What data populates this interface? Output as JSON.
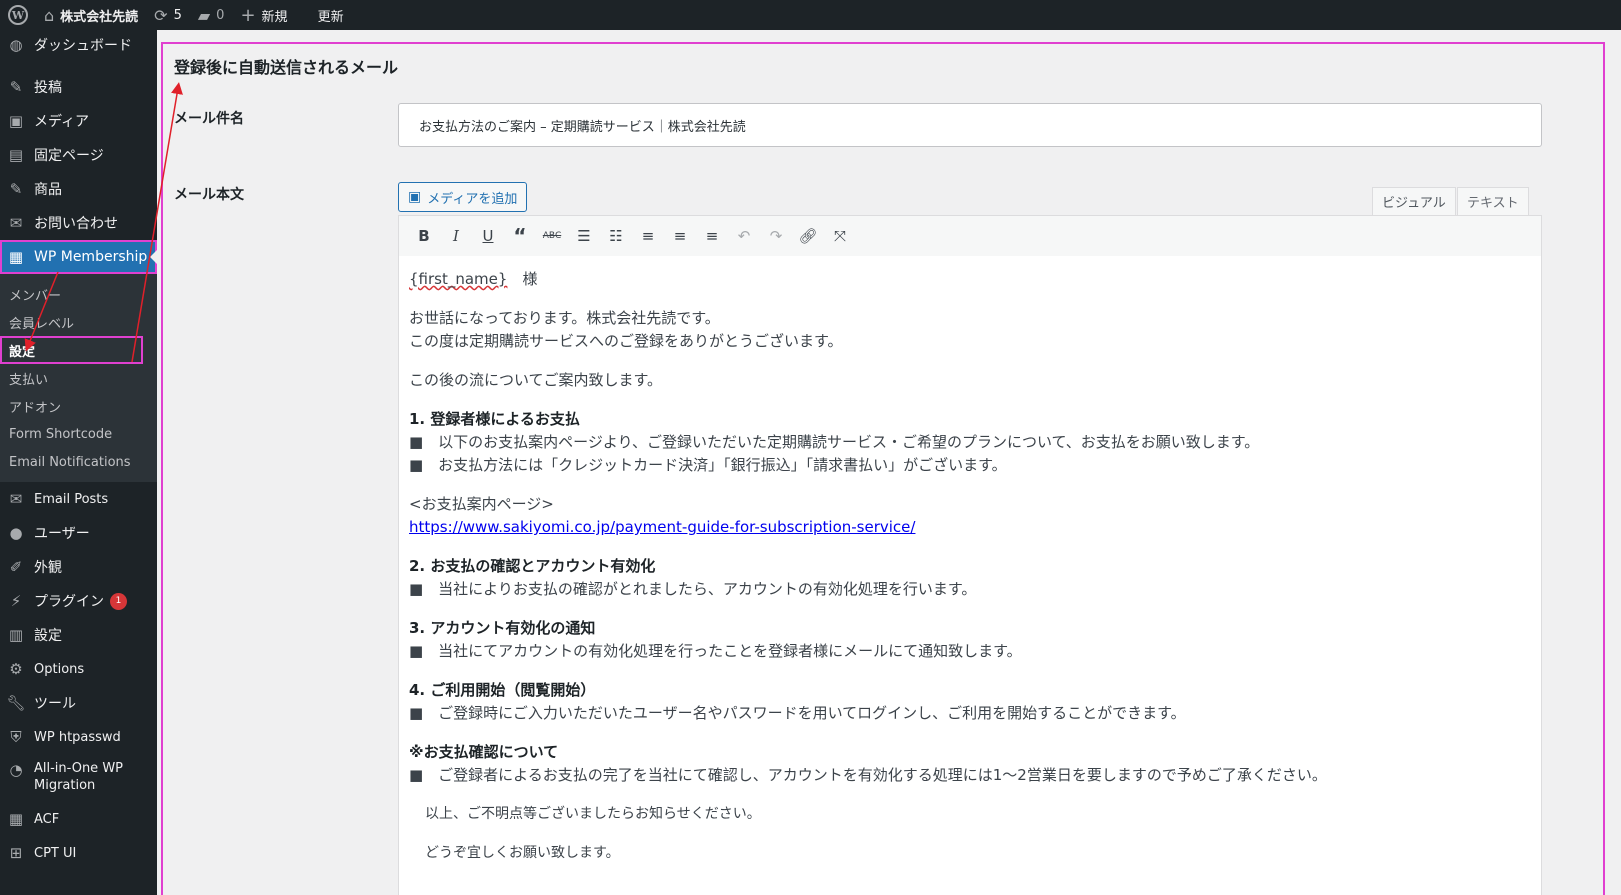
{
  "adminbar": {
    "site_name": "株式会社先読",
    "updates_count": "5",
    "comments_count": "0",
    "new_label": "新規",
    "update_label": "更新"
  },
  "sidebar": {
    "top_items": [
      {
        "label": "ダッシュボード",
        "icon": "dashboard-icon"
      },
      {
        "label": "投稿",
        "icon": "pin-icon"
      },
      {
        "label": "メディア",
        "icon": "media-icon"
      },
      {
        "label": "固定ページ",
        "icon": "page-icon"
      },
      {
        "label": "商品",
        "icon": "pin-icon"
      },
      {
        "label": "お問い合わせ",
        "icon": "mail-icon"
      }
    ],
    "current": {
      "label": "WP Membership",
      "icon": "id-card-icon"
    },
    "submenu": [
      {
        "label": "メンバー"
      },
      {
        "label": "会員レベル"
      },
      {
        "label": "設定"
      },
      {
        "label": "支払い"
      },
      {
        "label": "アドオン"
      },
      {
        "label": "Form Shortcode"
      },
      {
        "label": "Email Notifications"
      }
    ],
    "bottom_items": [
      {
        "label": "Email Posts",
        "icon": "mail-icon"
      },
      {
        "label": "ユーザー",
        "icon": "user-icon"
      },
      {
        "label": "外観",
        "icon": "brush-icon"
      },
      {
        "label": "プラグイン",
        "icon": "plugin-icon",
        "badge": "1"
      },
      {
        "label": "設定",
        "icon": "settings-icon"
      },
      {
        "label": "Options",
        "icon": "gear-icon"
      },
      {
        "label": "ツール",
        "icon": "wrench-icon"
      },
      {
        "label": "WP htpasswd",
        "icon": "shield-icon"
      },
      {
        "label": "All-in-One WP Migration",
        "icon": "migration-icon"
      },
      {
        "label": "ACF",
        "icon": "grid-icon"
      },
      {
        "label": "CPT UI",
        "icon": "cpt-icon"
      }
    ]
  },
  "main": {
    "section_title": "登録後に自動送信されるメール",
    "subject_label": "メール件名",
    "subject_value": "お支払方法のご案内 – 定期購読サービス｜株式会社先読",
    "body_label": "メール本文",
    "add_media_label": "メディアを追加",
    "tab_visual": "ビジュアル",
    "tab_text": "テキスト",
    "toolbar": [
      "bold",
      "italic",
      "underline",
      "blockquote",
      "strikethrough",
      "bullet-list",
      "numbered-list",
      "align-left",
      "align-center",
      "align-right",
      "undo",
      "redo",
      "link",
      "fullscreen"
    ],
    "editor": {
      "greeting_var": "{first_name}",
      "greeting_suffix": "　様",
      "p1_l1": "お世話になっております。株式会社先読です。",
      "p1_l2": "この度は定期購読サービスへのご登録をありがとうございます。",
      "p2": "この後の流についてご案内致します。",
      "s1_title": "1.  登録者様によるお支払",
      "s1_b1": "■　以下のお支払案内ページより、ご登録いただいた定期購読サービス・ご希望のプランについて、お支払をお願い致します。",
      "s1_b2": "■　お支払方法には「クレジットカード決済」「銀行振込」「請求書払い」がございます。",
      "guide_label": "<お支払案内ページ>",
      "guide_url": "https://www.sakiyomi.co.jp/payment-guide-for-subscription-service/",
      "s2_title": "2.  お支払の確認とアカウント有効化",
      "s2_b1": "■　当社によりお支払の確認がとれましたら、アカウントの有効化処理を行います。",
      "s3_title": "3.  アカウント有効化の通知",
      "s3_b1": "■　当社にてアカウントの有効化処理を行ったことを登録者様にメールにて通知致します。",
      "s4_title": "4.  ご利用開始（閲覧開始）",
      "s4_b1": "■　ご登録時にご入力いただいたユーザー名やパスワードを用いてログインし、ご利用を開始することができます。",
      "note_title": "※お支払確認について",
      "note_b1": "■　ご登録者によるお支払の完了を当社にて確認し、アカウントを有効化する処理には1〜2営業日を要しますので予めご了承ください。",
      "closing1": "以上、ご不明点等ございましたらお知らせください。",
      "closing2": "どうぞ宜しくお願い致します。"
    }
  },
  "colors": {
    "admin_dark": "#1d2327",
    "accent_blue": "#2271b1",
    "annotation_magenta": "#e040d0",
    "annotation_red": "#e0202a"
  }
}
